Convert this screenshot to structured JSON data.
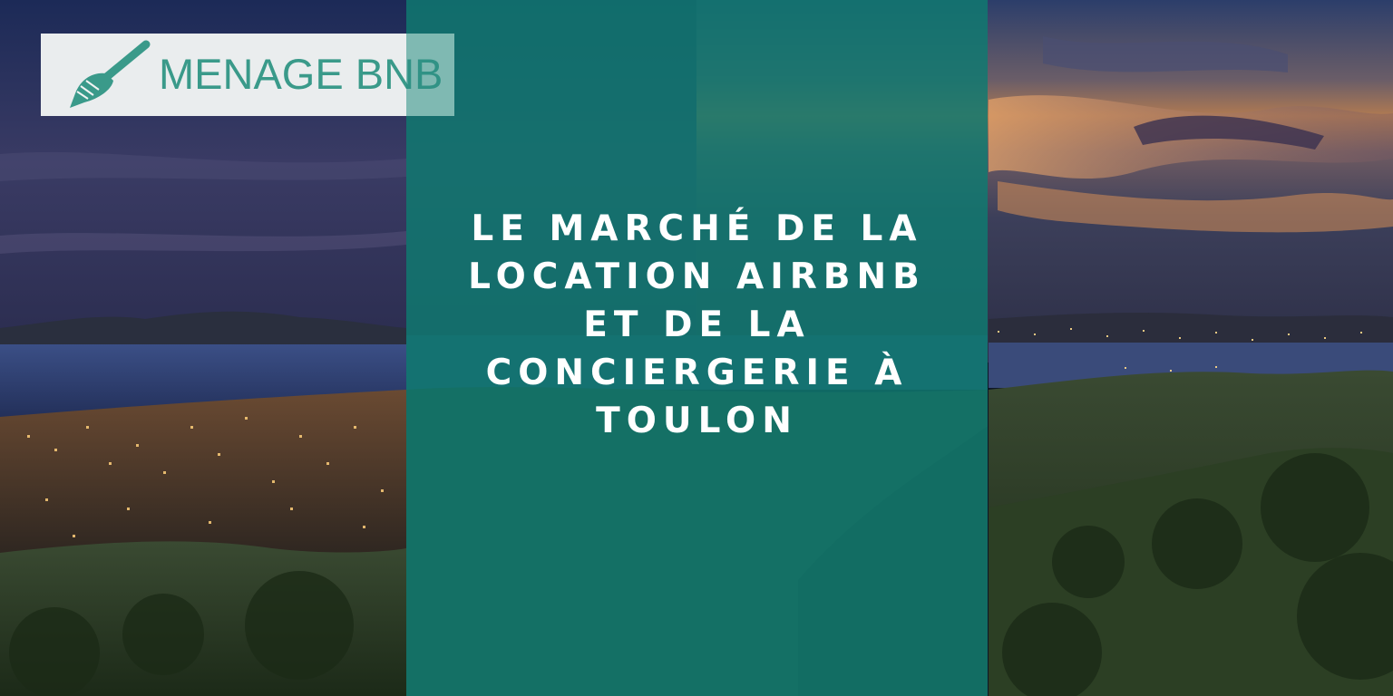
{
  "brand": {
    "name": "MENAGE BNB",
    "icon": "broom-icon",
    "color": "#3a9a8a"
  },
  "headline": {
    "lines": [
      "LE MARCHÉ DE LA",
      "LOCATION AIRBNB",
      "ET DE LA",
      "CONCIERGERIE À",
      "TOULON"
    ]
  },
  "colors": {
    "overlay": "#107a70",
    "headline_text": "#ffffff"
  }
}
